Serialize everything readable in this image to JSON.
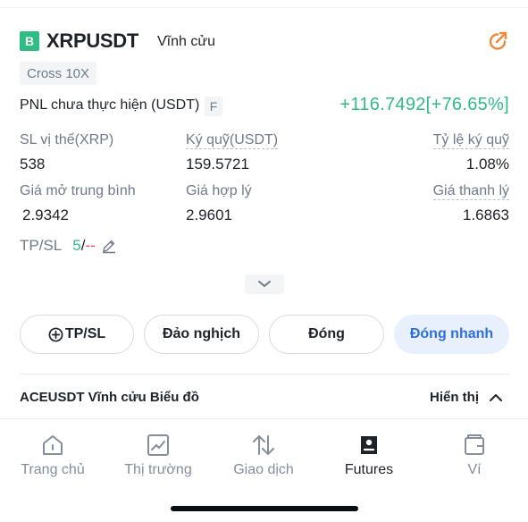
{
  "position": {
    "side_badge": "B",
    "symbol": "XRPUSDT",
    "contract_type": "Vĩnh cửu",
    "margin_mode": "Cross 10X",
    "pnl_label": "PNL chưa thực hiện (USDT)",
    "pnl_tag": "F",
    "pnl_value": "+116.7492[+76.65%]",
    "accent_color": "#2ebd85",
    "share_icon_color": "#f0883a"
  },
  "stats": [
    {
      "label": "SL vị thế(XRP)",
      "value": "538"
    },
    {
      "label": "Ký quỹ(USDT)",
      "value": "159.5721"
    },
    {
      "label": "Tỷ lệ ký quỹ",
      "value": "1.08%"
    },
    {
      "label": "Giá mở trung bình",
      "value": "2.9342"
    },
    {
      "label": "Giá hợp lý",
      "value": "2.9601"
    },
    {
      "label": "Giá thanh lý",
      "value": "1.6863"
    }
  ],
  "tpsl": {
    "label": "TP/SL",
    "tp": "5",
    "sep": "/",
    "sl": "--"
  },
  "buttons": {
    "tpsl": "TP/SL",
    "reverse": "Đảo nghịch",
    "close": "Đóng",
    "quick_close": "Đóng nhanh"
  },
  "chart_section": {
    "label": "ACEUSDT Vĩnh cửu Biểu đồ",
    "toggle": "Hiển thị"
  },
  "nav": [
    {
      "label": "Trang chủ",
      "icon": "home-icon"
    },
    {
      "label": "Thị trường",
      "icon": "market-chart-icon"
    },
    {
      "label": "Giao dịch",
      "icon": "trade-arrows-icon"
    },
    {
      "label": "Futures",
      "icon": "futures-icon"
    },
    {
      "label": "Ví",
      "icon": "wallet-icon"
    }
  ]
}
